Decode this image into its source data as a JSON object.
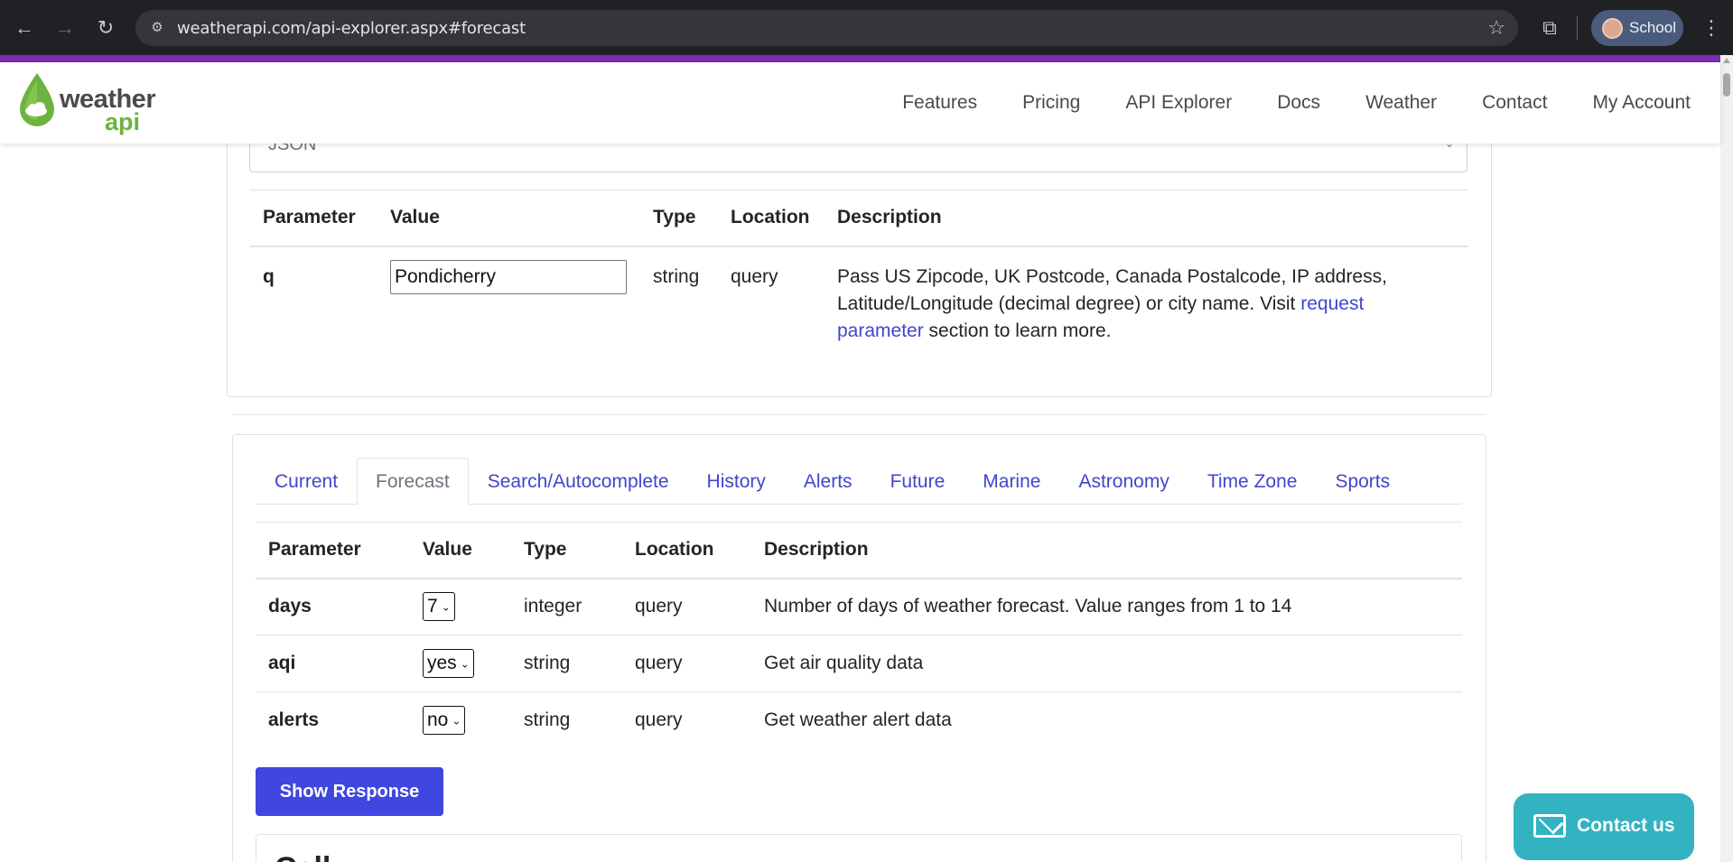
{
  "browser": {
    "url": "weatherapi.com/api-explorer.aspx#forecast",
    "profile_name": "School"
  },
  "site": {
    "logo_line1": "weather",
    "logo_line2": "api",
    "brand_green": "#6cb33f",
    "accent_purple": "#7c2bb4",
    "nav": [
      "Features",
      "Pricing",
      "API Explorer",
      "Docs",
      "Weather",
      "Contact",
      "My Account"
    ]
  },
  "format_select": {
    "value": "JSON"
  },
  "common_table": {
    "headers": [
      "Parameter",
      "Value",
      "Type",
      "Location",
      "Description"
    ],
    "row": {
      "parameter": "q",
      "value": "Pondicherry",
      "type": "string",
      "location": "query",
      "description_pre": "Pass US Zipcode, UK Postcode, Canada Postalcode, IP address, Latitude/Longitude (decimal degree) or city name. Visit ",
      "description_link": "request parameter",
      "description_post": " section to learn more."
    }
  },
  "tabs": {
    "items": [
      "Current",
      "Forecast",
      "Search/Autocomplete",
      "History",
      "Alerts",
      "Future",
      "Marine",
      "Astronomy",
      "Time Zone",
      "Sports"
    ],
    "active": "Forecast"
  },
  "forecast_table": {
    "headers": [
      "Parameter",
      "Value",
      "Type",
      "Location",
      "Description"
    ],
    "rows": [
      {
        "parameter": "days",
        "value": "7",
        "type": "integer",
        "location": "query",
        "description": "Number of days of weather forecast. Value ranges from 1 to 14"
      },
      {
        "parameter": "aqi",
        "value": "yes",
        "type": "string",
        "location": "query",
        "description": "Get air quality data"
      },
      {
        "parameter": "alerts",
        "value": "no",
        "type": "string",
        "location": "query",
        "description": "Get weather alert data"
      }
    ]
  },
  "show_response_label": "Show Response",
  "next_section_heading": "Call",
  "contact_label": "Contact us",
  "colors": {
    "link": "#4046cc",
    "button": "#4046e0",
    "contact": "#33b2c2"
  }
}
